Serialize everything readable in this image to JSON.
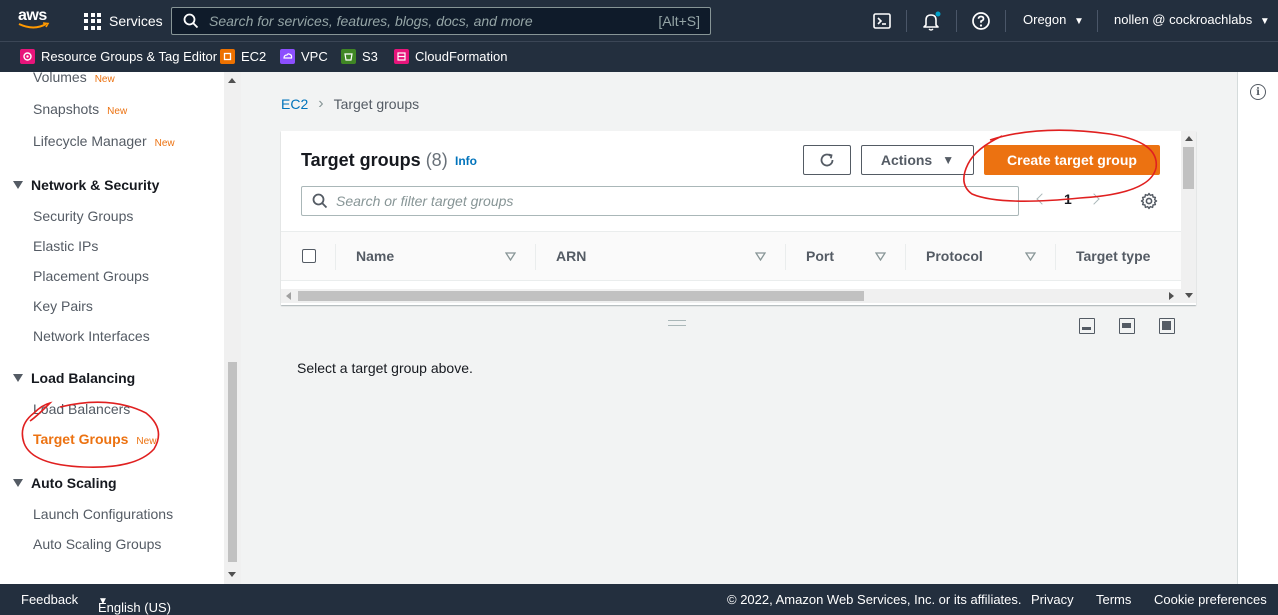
{
  "topnav": {
    "logo_text": "aws",
    "services_label": "Services",
    "search_placeholder": "Search for services, features, blogs, docs, and more",
    "search_shortcut": "[Alt+S]",
    "region": "Oregon",
    "account": "nollen @ cockroachlabs"
  },
  "favorites": [
    {
      "label": "Resource Groups & Tag Editor",
      "color": "#e7157b"
    },
    {
      "label": "EC2",
      "color": "#ed7100"
    },
    {
      "label": "VPC",
      "color": "#8c4fff"
    },
    {
      "label": "S3",
      "color": "#3f8624"
    },
    {
      "label": "CloudFormation",
      "color": "#e7157b"
    }
  ],
  "sidebar": {
    "items": [
      {
        "label": "Volumes",
        "badge": "New"
      },
      {
        "label": "Snapshots",
        "badge": "New"
      },
      {
        "label": "Lifecycle Manager",
        "badge": "New"
      }
    ],
    "network_section": "Network & Security",
    "network_items": [
      "Security Groups",
      "Elastic IPs",
      "Placement Groups",
      "Key Pairs",
      "Network Interfaces"
    ],
    "lb_section": "Load Balancing",
    "lb_items": [
      {
        "label": "Load Balancers",
        "badge": ""
      },
      {
        "label": "Target Groups",
        "badge": "New"
      }
    ],
    "as_section": "Auto Scaling",
    "as_items": [
      "Launch Configurations",
      "Auto Scaling Groups"
    ]
  },
  "breadcrumb": {
    "root": "EC2",
    "current": "Target groups"
  },
  "panel": {
    "title": "Target groups",
    "count": "(8)",
    "info": "Info",
    "actions_label": "Actions",
    "create_label": "Create target group",
    "filter_placeholder": "Search or filter target groups",
    "page": "1",
    "columns": [
      "Name",
      "ARN",
      "Port",
      "Protocol",
      "Target type"
    ]
  },
  "detail": {
    "empty_text": "Select a target group above."
  },
  "footer": {
    "feedback": "Feedback",
    "language": "English (US)",
    "copyright": "© 2022, Amazon Web Services, Inc. or its affiliates.",
    "privacy": "Privacy",
    "terms": "Terms",
    "cookies": "Cookie preferences"
  },
  "colors": {
    "accent": "#ec7211",
    "link": "#0073bb",
    "nav": "#232f3e",
    "annotation": "#e02020"
  }
}
